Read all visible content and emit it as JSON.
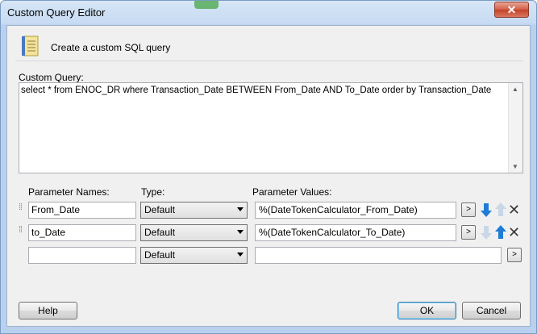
{
  "window": {
    "title": "Custom Query Editor",
    "close_glyph": "✕"
  },
  "header": {
    "text": "Create a custom SQL query",
    "icon": "notebook-icon"
  },
  "query": {
    "label": "Custom Query:",
    "text": "select * from ENOC_DR where Transaction_Date BETWEEN From_Date AND To_Date order by Transaction_Date"
  },
  "params": {
    "headers": {
      "names": "Parameter Names:",
      "type": "Type:",
      "values": "Parameter Values:"
    },
    "rows": [
      {
        "name": "From_Date",
        "type": "Default",
        "value": "%(DateTokenCalculator_From_Date)",
        "browse": ">"
      },
      {
        "name": "to_Date",
        "type": "Default",
        "value": "%(DateTokenCalculator_To_Date)",
        "browse": ">"
      },
      {
        "name": "",
        "type": "Default",
        "value": "",
        "browse": ">"
      }
    ]
  },
  "buttons": {
    "help": "Help",
    "ok": "OK",
    "cancel": "Cancel"
  },
  "colors": {
    "arrow_active": "#1f7bd6",
    "arrow_disabled": "#c9d7e6"
  }
}
